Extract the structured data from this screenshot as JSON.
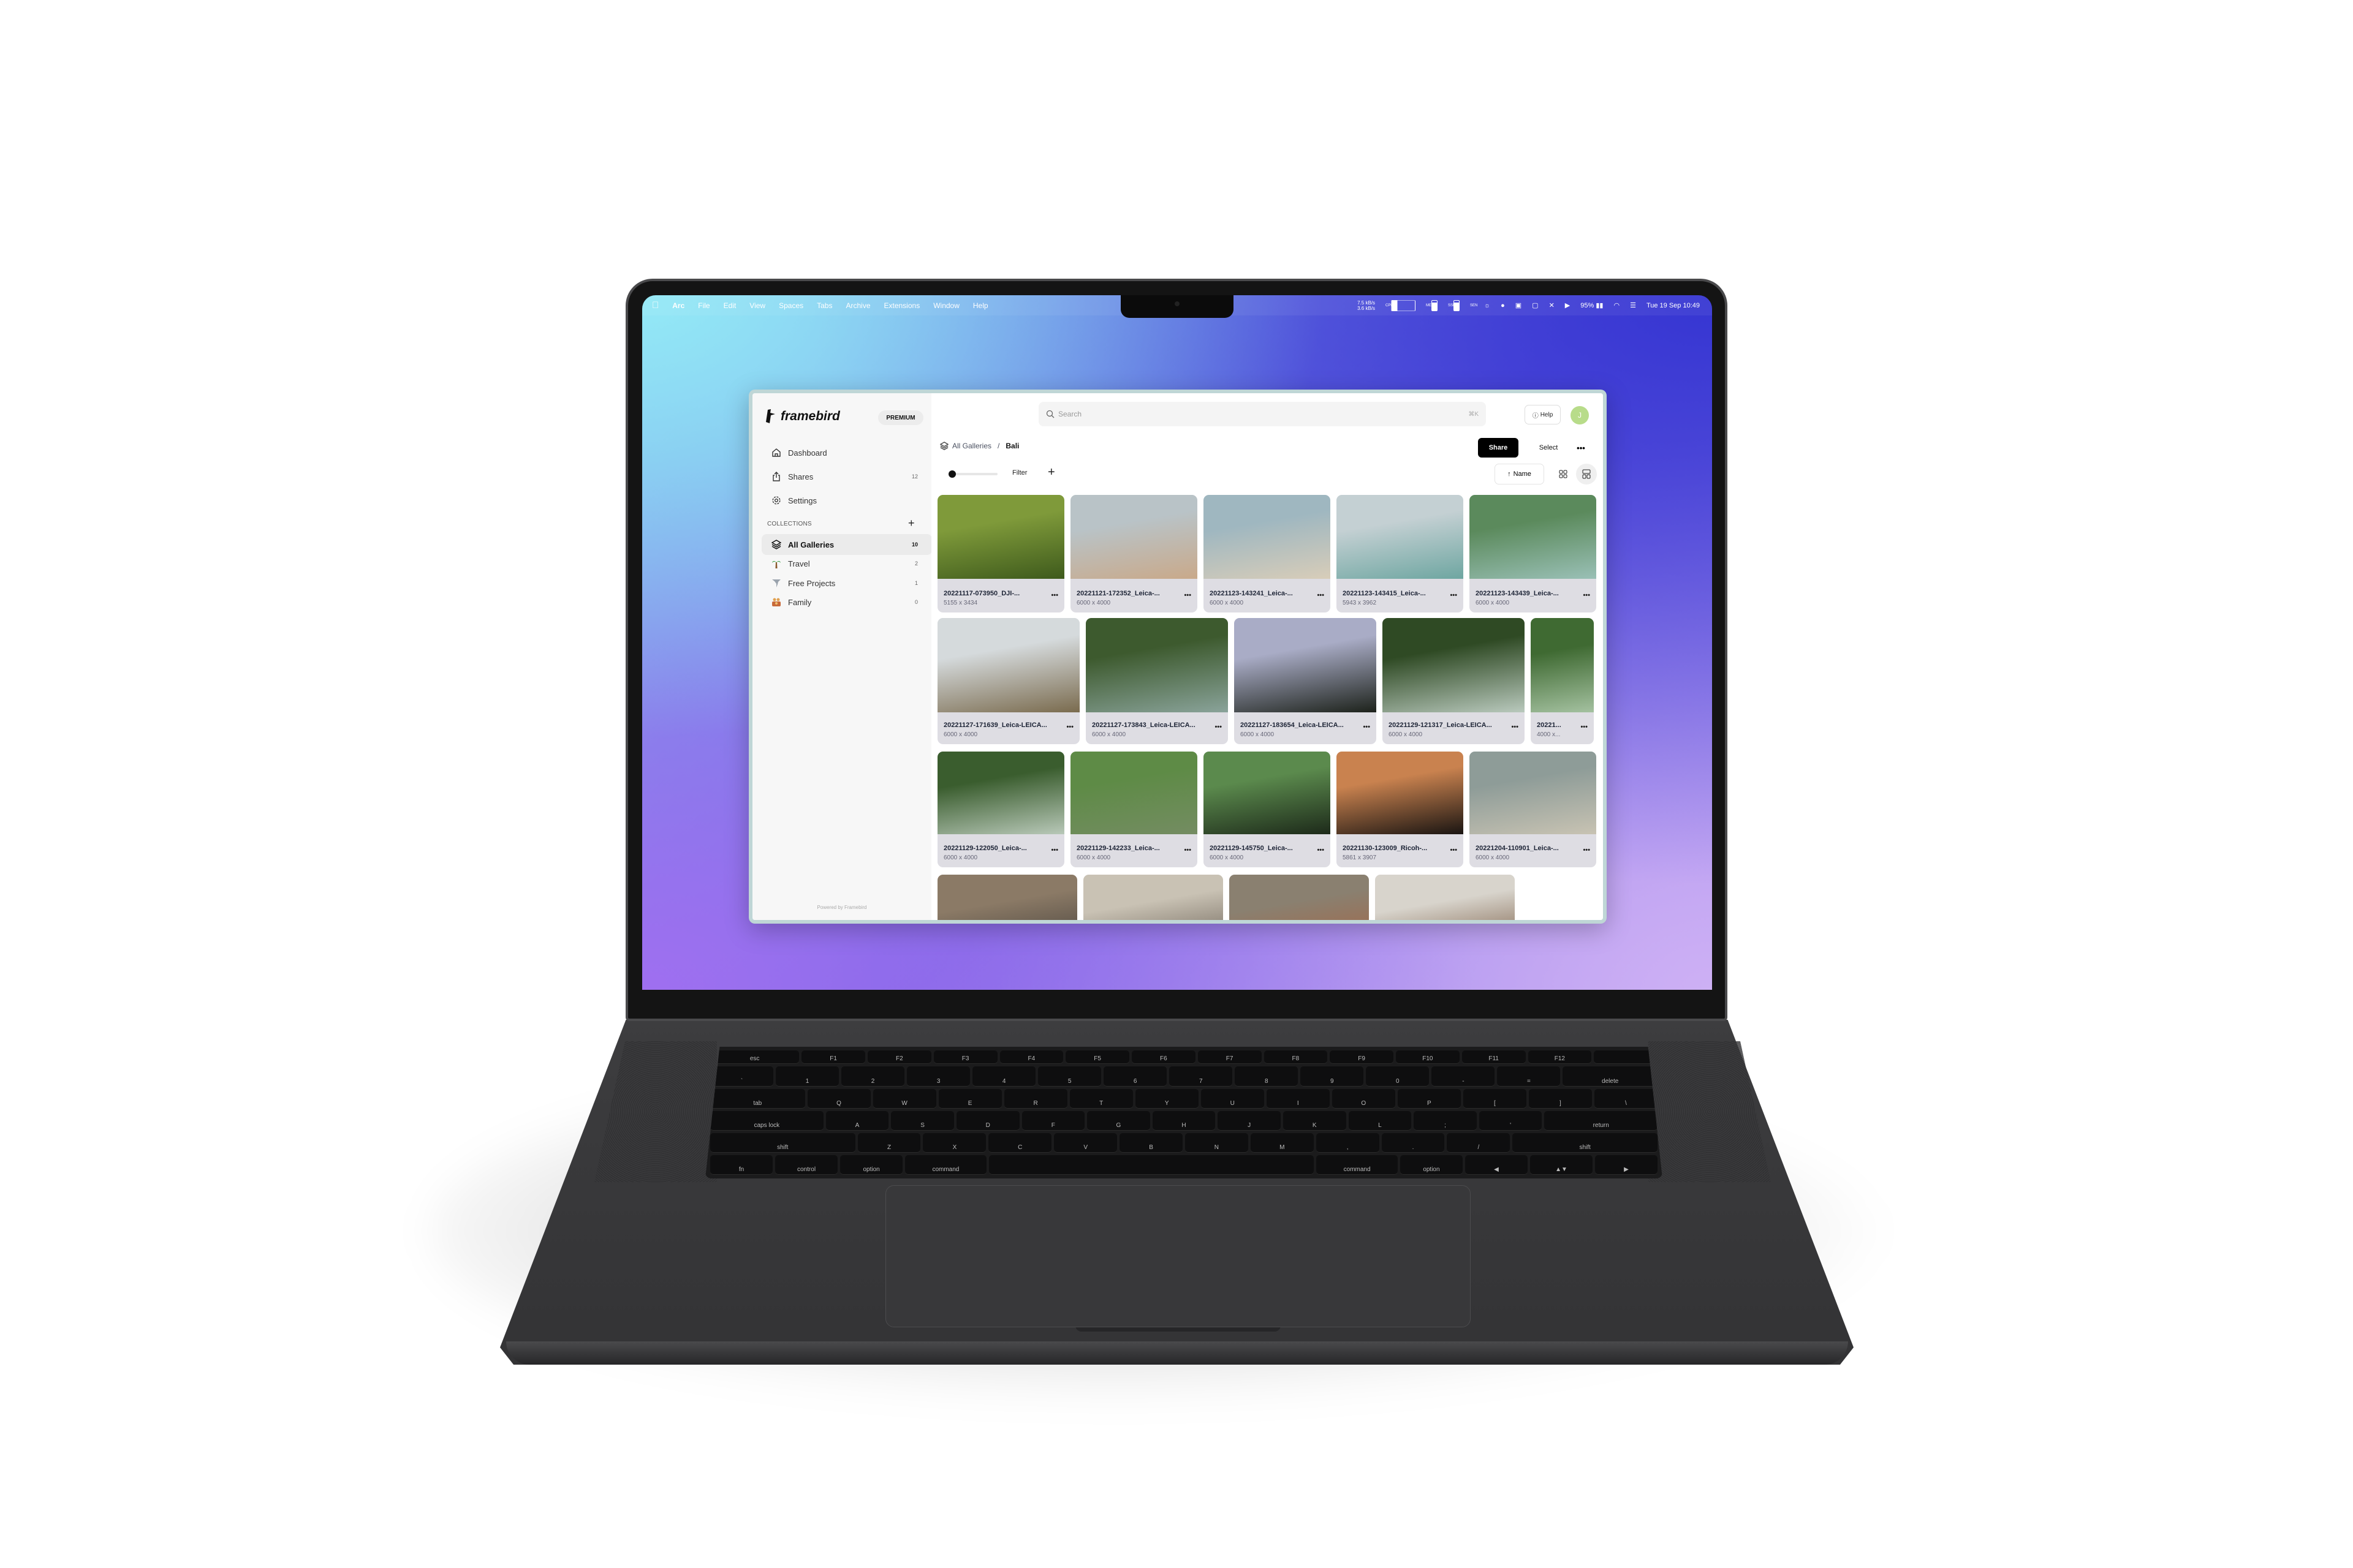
{
  "menubar": {
    "apple_icon": "apple-logo-icon",
    "items": [
      "Arc",
      "File",
      "Edit",
      "View",
      "Spaces",
      "Tabs",
      "Archive",
      "Extensions",
      "Window",
      "Help"
    ],
    "status": {
      "net_up": "7.5 kB/s",
      "net_down": "3.6 kB/s",
      "cpu_label": "CPU",
      "mem_label": "MEM",
      "ssd_label": "SSD",
      "sen_label": "SEN",
      "battery": "95%",
      "datetime": "Tue 19 Sep 10:49"
    }
  },
  "sidebar": {
    "logo": "framebird",
    "badge": "PREMIUM",
    "nav": [
      {
        "label": "Dashboard",
        "icon": "home-icon"
      },
      {
        "label": "Shares",
        "count": "12",
        "icon": "share-icon"
      },
      {
        "label": "Settings",
        "icon": "gear-icon"
      }
    ],
    "collections_label": "COLLECTIONS",
    "collections": [
      {
        "label": "All Galleries",
        "count": "10",
        "icon": "layers-icon",
        "active": true
      },
      {
        "label": "Travel",
        "count": "2",
        "icon": "palm-tree-icon"
      },
      {
        "label": "Free Projects",
        "count": "1",
        "icon": "tornado-icon"
      },
      {
        "label": "Family",
        "count": "0",
        "icon": "family-icon"
      }
    ],
    "powered_by": "Powered by Framebird"
  },
  "header": {
    "search_placeholder": "Search",
    "search_shortcut": "⌘K",
    "help_label": "Help",
    "avatar_initial": "J",
    "avatar_color": "#b8dc8a"
  },
  "breadcrumb": {
    "parent": "All Galleries",
    "separator": "/",
    "current": "Bali"
  },
  "actions": {
    "share": "Share",
    "select": "Select",
    "more": "•••"
  },
  "toolbar": {
    "filter": "Filter",
    "sort": "Name",
    "sort_direction": "ascending",
    "view_mode": "masonry"
  },
  "photos": [
    [
      {
        "name": "20221117-073950_DJI-...",
        "dims": "5155 x 3434",
        "tones": [
          "#7f9a3a",
          "#3e5a1c"
        ]
      },
      {
        "name": "20221121-172352_Leica-...",
        "dims": "6000 x 4000",
        "tones": [
          "#b9c3c7",
          "#c9a98a"
        ]
      },
      {
        "name": "20221123-143241_Leica-...",
        "dims": "6000 x 4000",
        "tones": [
          "#9fb7c0",
          "#d8cdb9"
        ]
      },
      {
        "name": "20221123-143415_Leica-...",
        "dims": "5943 x 3962",
        "tones": [
          "#c4d0d3",
          "#6ea6a1"
        ]
      },
      {
        "name": "20221123-143439_Leica-...",
        "dims": "6000 x 4000",
        "tones": [
          "#5b8a5c",
          "#9ac0b6"
        ]
      }
    ],
    [
      {
        "name": "20221127-171639_Leica-LEICA...",
        "dims": "6000 x 4000",
        "tones": [
          "#d5dadc",
          "#7a6b4e"
        ]
      },
      {
        "name": "20221127-173843_Leica-LEICA...",
        "dims": "6000 x 4000",
        "tones": [
          "#3d5a2e",
          "#8aa39a"
        ]
      },
      {
        "name": "20221127-183654_Leica-LEICA...",
        "dims": "6000 x 4000",
        "tones": [
          "#a9acc6",
          "#1d221b"
        ]
      },
      {
        "name": "20221129-121317_Leica-LEICA...",
        "dims": "6000 x 4000",
        "tones": [
          "#2f4a24",
          "#b9c9bd"
        ]
      },
      {
        "name": "20221...",
        "dims": "4000 x...",
        "tones": [
          "#3f6a32",
          "#a4c1a0"
        ]
      }
    ],
    [
      {
        "name": "20221129-122050_Leica-...",
        "dims": "6000 x 4000",
        "tones": [
          "#3a5d2e",
          "#b8c8b8"
        ]
      },
      {
        "name": "20221129-142233_Leica-...",
        "dims": "6000 x 4000",
        "tones": [
          "#5e8b46",
          "#748c62"
        ]
      },
      {
        "name": "20221129-145750_Leica-...",
        "dims": "6000 x 4000",
        "tones": [
          "#5b8a4d",
          "#1d2a1a"
        ]
      },
      {
        "name": "20221130-123009_Ricoh-...",
        "dims": "5861 x 3907",
        "tones": [
          "#c9824f",
          "#1a1512"
        ]
      },
      {
        "name": "20221204-110901_Leica-...",
        "dims": "6000 x 4000",
        "tones": [
          "#8e9c98",
          "#c8c3b3"
        ]
      }
    ],
    [
      {
        "tones": [
          "#8b7a66",
          "#3e3a36"
        ]
      },
      {
        "tones": [
          "#c9c2b4",
          "#5c5247"
        ]
      },
      {
        "tones": [
          "#8a8070",
          "#a8623f"
        ]
      },
      {
        "tones": [
          "#d8d4cc",
          "#6a4a30"
        ]
      }
    ]
  ],
  "keyboard": [
    [
      [
        "esc",
        1.4
      ],
      [
        "F1",
        1
      ],
      [
        "F2",
        1
      ],
      [
        "F3",
        1
      ],
      [
        "F4",
        1
      ],
      [
        "F5",
        1
      ],
      [
        "F6",
        1
      ],
      [
        "F7",
        1
      ],
      [
        "F8",
        1
      ],
      [
        "F9",
        1
      ],
      [
        "F10",
        1
      ],
      [
        "F11",
        1
      ],
      [
        "F12",
        1
      ],
      [
        "",
        1
      ]
    ],
    [
      [
        "`",
        1
      ],
      [
        "1",
        1
      ],
      [
        "2",
        1
      ],
      [
        "3",
        1
      ],
      [
        "4",
        1
      ],
      [
        "5",
        1
      ],
      [
        "6",
        1
      ],
      [
        "7",
        1
      ],
      [
        "8",
        1
      ],
      [
        "9",
        1
      ],
      [
        "0",
        1
      ],
      [
        "-",
        1
      ],
      [
        "=",
        1
      ],
      [
        "delete",
        1.5
      ]
    ],
    [
      [
        "tab",
        1.5
      ],
      [
        "Q",
        1
      ],
      [
        "W",
        1
      ],
      [
        "E",
        1
      ],
      [
        "R",
        1
      ],
      [
        "T",
        1
      ],
      [
        "Y",
        1
      ],
      [
        "U",
        1
      ],
      [
        "I",
        1
      ],
      [
        "O",
        1
      ],
      [
        "P",
        1
      ],
      [
        "[",
        1
      ],
      [
        "]",
        1
      ],
      [
        "\\",
        1
      ]
    ],
    [
      [
        "caps lock",
        1.8
      ],
      [
        "A",
        1
      ],
      [
        "S",
        1
      ],
      [
        "D",
        1
      ],
      [
        "F",
        1
      ],
      [
        "G",
        1
      ],
      [
        "H",
        1
      ],
      [
        "J",
        1
      ],
      [
        "K",
        1
      ],
      [
        "L",
        1
      ],
      [
        ";",
        1
      ],
      [
        "'",
        1
      ],
      [
        "return",
        1.8
      ]
    ],
    [
      [
        "shift",
        2.3
      ],
      [
        "Z",
        1
      ],
      [
        "X",
        1
      ],
      [
        "C",
        1
      ],
      [
        "V",
        1
      ],
      [
        "B",
        1
      ],
      [
        "N",
        1
      ],
      [
        "M",
        1
      ],
      [
        ",",
        1
      ],
      [
        ".",
        1
      ],
      [
        "/",
        1
      ],
      [
        "shift",
        2.3
      ]
    ],
    [
      [
        "fn",
        1
      ],
      [
        "control",
        1
      ],
      [
        "option",
        1
      ],
      [
        "command",
        1.3
      ],
      [
        "",
        5.2
      ],
      [
        "command",
        1.3
      ],
      [
        "option",
        1
      ],
      [
        "◀",
        1
      ],
      [
        "▲▼",
        1
      ],
      [
        "▶",
        1
      ]
    ]
  ]
}
